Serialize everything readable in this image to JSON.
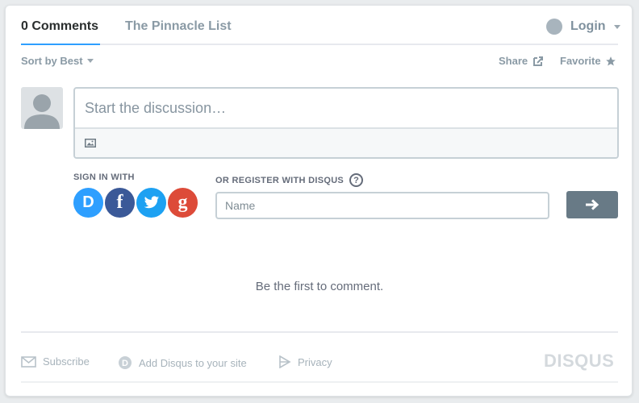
{
  "nav": {
    "comments_tab": "0 Comments",
    "list_tab": "The Pinnacle List",
    "login_label": "Login"
  },
  "toolbar": {
    "sort_label": "Sort by Best",
    "share_label": "Share",
    "favorite_label": "Favorite"
  },
  "composer": {
    "placeholder": "Start the discussion…"
  },
  "signin": {
    "label": "SIGN IN WITH",
    "providers": [
      "D",
      "f",
      "g"
    ]
  },
  "register": {
    "label": "OR REGISTER WITH DISQUS",
    "help": "?",
    "name_placeholder": "Name"
  },
  "empty_state": "Be the first to comment.",
  "footer": {
    "subscribe": "Subscribe",
    "add_disqus": "Add Disqus to your site",
    "privacy": "Privacy",
    "logo_text": "DISQUS"
  },
  "colors": {
    "accent": "#2e9fff",
    "disqus": "#2e9fff",
    "facebook": "#3b5998",
    "twitter": "#1da1f2",
    "google": "#dd4b39",
    "submit": "#687a86"
  }
}
